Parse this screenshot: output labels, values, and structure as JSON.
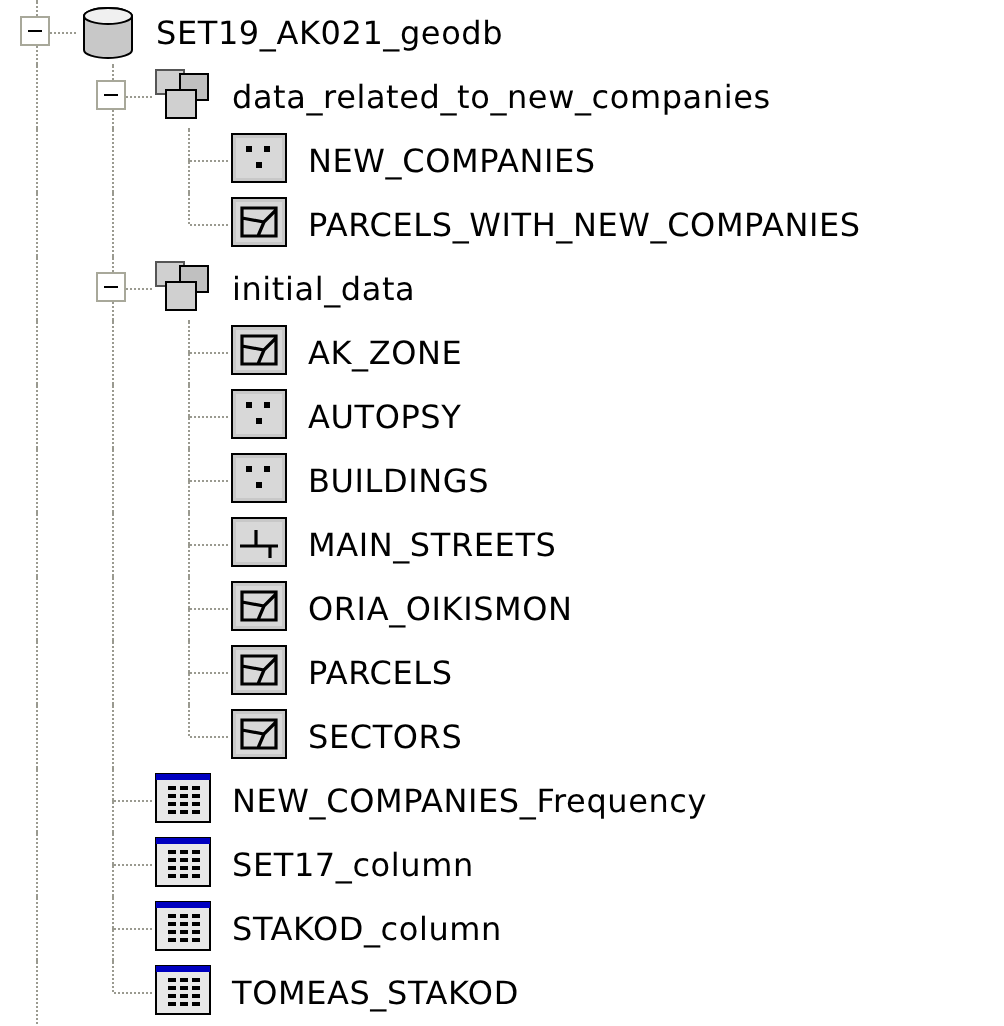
{
  "tree": [
    {
      "label": "SET19_AK021_geodb",
      "kind": "database",
      "expanded": true,
      "children": [
        {
          "label": "data_related_to_new_companies",
          "kind": "dataset",
          "expanded": true,
          "children": [
            {
              "label": "NEW_COMPANIES",
              "kind": "point"
            },
            {
              "label": "PARCELS_WITH_NEW_COMPANIES",
              "kind": "polygon"
            }
          ]
        },
        {
          "label": "initial_data",
          "kind": "dataset",
          "expanded": true,
          "children": [
            {
              "label": "AK_ZONE",
              "kind": "polygon"
            },
            {
              "label": "AUTOPSY",
              "kind": "point"
            },
            {
              "label": "BUILDINGS",
              "kind": "point"
            },
            {
              "label": "MAIN_STREETS",
              "kind": "line"
            },
            {
              "label": "ORIA_OIKISMON",
              "kind": "polygon"
            },
            {
              "label": "PARCELS",
              "kind": "polygon"
            },
            {
              "label": "SECTORS",
              "kind": "polygon"
            }
          ]
        },
        {
          "label": "NEW_COMPANIES_Frequency",
          "kind": "table"
        },
        {
          "label": "SET17_column",
          "kind": "table"
        },
        {
          "label": "STAKOD_column",
          "kind": "table"
        },
        {
          "label": "TOMEAS_STAKOD",
          "kind": "table"
        }
      ]
    }
  ]
}
